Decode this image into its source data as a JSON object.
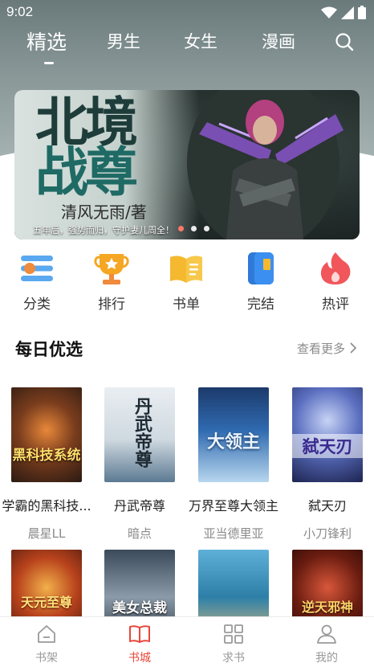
{
  "status_bar": {
    "time": "9:02"
  },
  "top_nav": {
    "tabs": [
      {
        "label": "精选",
        "active": true
      },
      {
        "label": "男生",
        "active": false
      },
      {
        "label": "女生",
        "active": false
      },
      {
        "label": "漫画",
        "active": false
      }
    ],
    "search_icon": "search-icon"
  },
  "banner": {
    "title_line1": "北境",
    "title_line2": "战尊",
    "author": "清风无雨/著",
    "tagline": "五年后，强势而归，守护妻儿周全！",
    "slides": 3,
    "active_slide": 0
  },
  "categories": [
    {
      "label": "分类",
      "icon": "category-icon",
      "color": "#f08a3c"
    },
    {
      "label": "排行",
      "icon": "trophy-icon",
      "color": "#f5a623"
    },
    {
      "label": "书单",
      "icon": "booklist-icon",
      "color": "#f5b92f"
    },
    {
      "label": "完结",
      "icon": "finished-book-icon",
      "color": "#3b8ff0"
    },
    {
      "label": "热评",
      "icon": "flame-icon",
      "color": "#f0565a"
    }
  ],
  "daily": {
    "title": "每日优选",
    "more": "查看更多",
    "books": [
      {
        "title": "学霸的黑科技...",
        "author": "晨星LL",
        "cover_text": "黑科技系统"
      },
      {
        "title": "丹武帝尊",
        "author": "暗点",
        "cover_text": "丹武帝尊"
      },
      {
        "title": "万界至尊大领主",
        "author": "亚当德里亚",
        "cover_text": "大领主"
      },
      {
        "title": "弑天刃",
        "author": "小刀锋利",
        "cover_text": "弑天刃"
      }
    ],
    "row2_covers": [
      {
        "cover_text": "天元至尊"
      },
      {
        "cover_text": "美女总裁"
      },
      {
        "cover_text": ""
      },
      {
        "cover_text": "逆天邪神"
      }
    ]
  },
  "bottom_nav": [
    {
      "label": "书架",
      "icon": "bookshelf-icon",
      "active": false
    },
    {
      "label": "书城",
      "icon": "book-open-icon",
      "active": true
    },
    {
      "label": "求书",
      "icon": "grid-icon",
      "active": false
    },
    {
      "label": "我的",
      "icon": "user-icon",
      "active": false
    }
  ],
  "colors": {
    "accent": "#e8473a",
    "muted": "#999999"
  }
}
